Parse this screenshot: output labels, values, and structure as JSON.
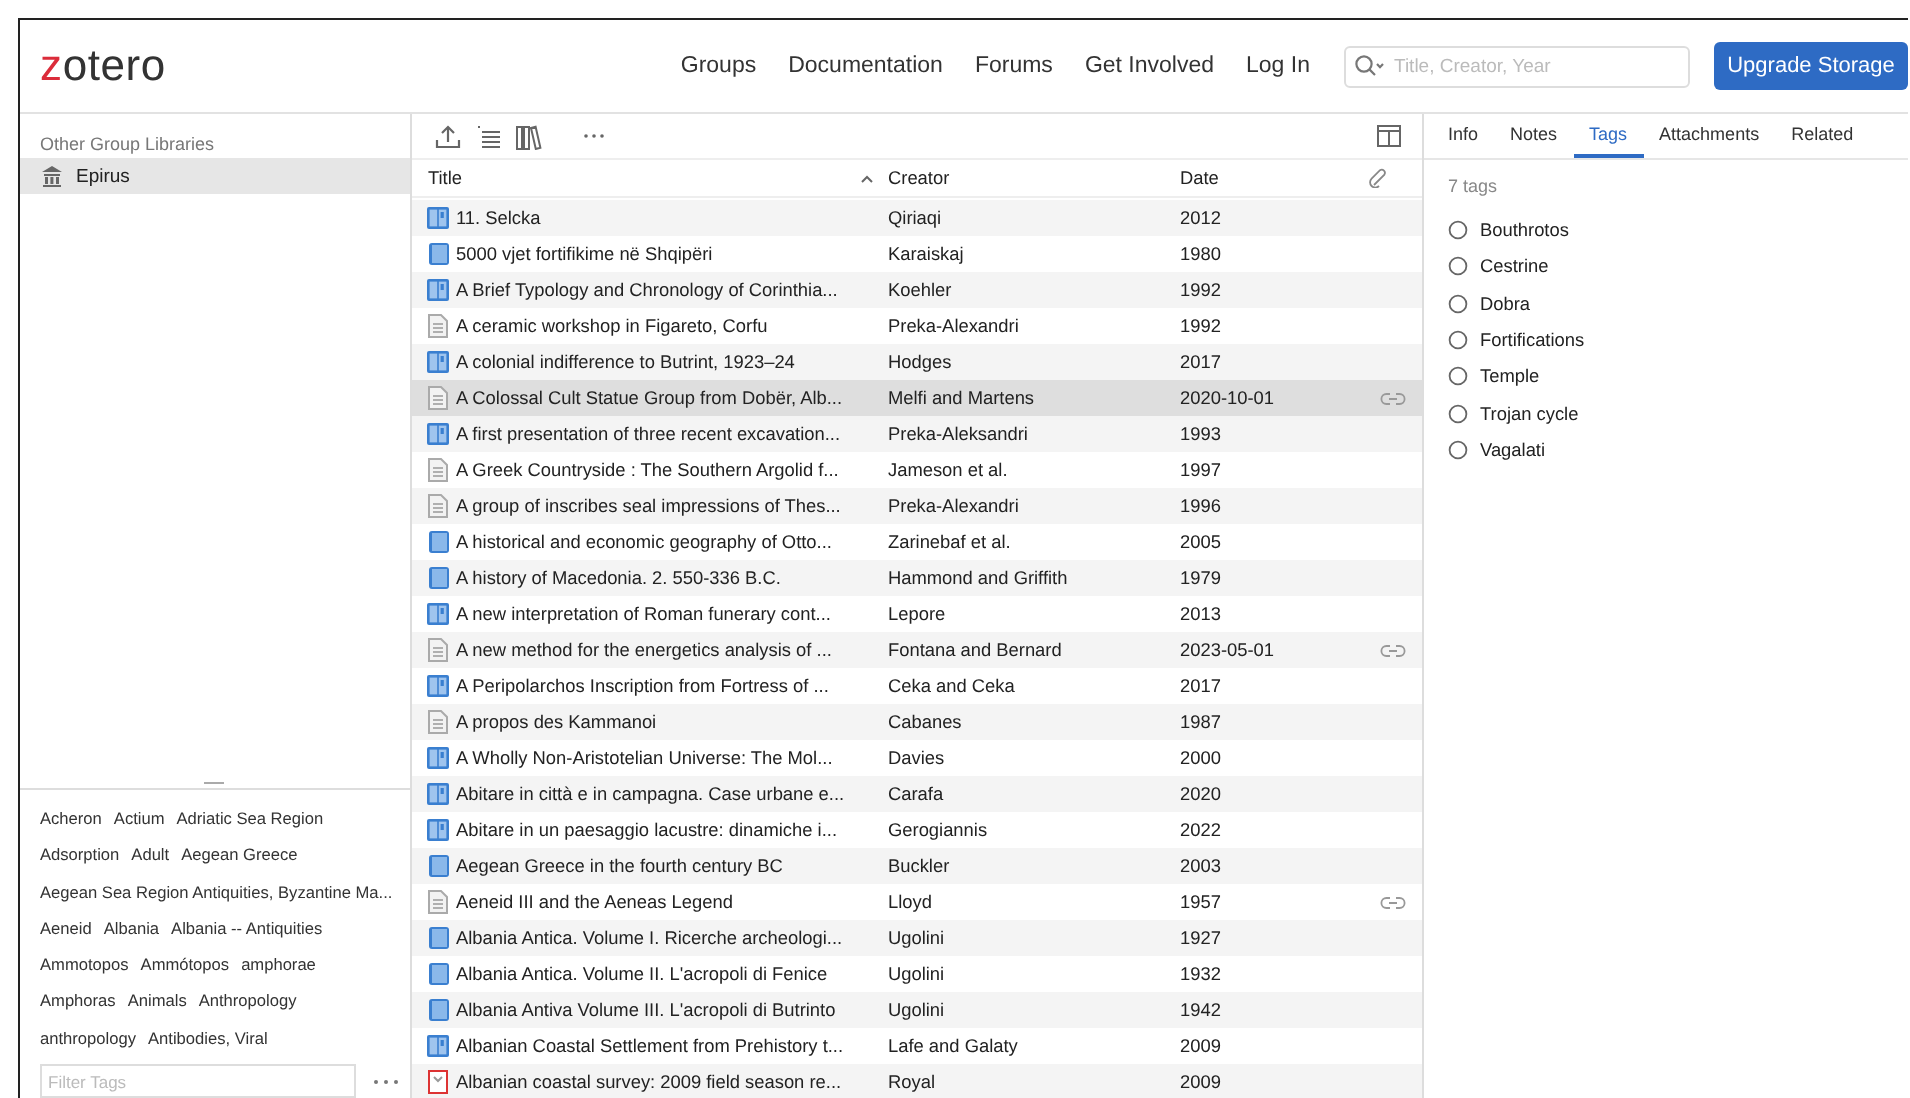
{
  "header": {
    "logo": {
      "accent": "z",
      "rest": "otero"
    },
    "nav": [
      "Groups",
      "Documentation",
      "Forums",
      "Get Involved",
      "Log In"
    ],
    "search": {
      "placeholder": "Title, Creator, Year"
    },
    "upgrade_button": "Upgrade Storage"
  },
  "sidebar": {
    "heading": "Other Group Libraries",
    "items": [
      {
        "label": "Epirus",
        "selected": true
      }
    ],
    "tags": [
      "Acheron",
      "Actium",
      "Adriatic Sea Region",
      "Adsorption",
      "Adult",
      "Aegean Greece",
      "Aegean Sea Region Antiquities, Byzantine Ma...",
      "Aeneid",
      "Albania",
      "Albania -- Antiquities",
      "Ammotopos",
      "Ammótopos",
      "amphorae",
      "Amphoras",
      "Animals",
      "Anthropology",
      "anthropology",
      "Antibodies, Viral"
    ],
    "filter": {
      "placeholder": "Filter Tags"
    }
  },
  "table": {
    "columns": [
      "Title",
      "Creator",
      "Date"
    ],
    "rows": [
      {
        "kind": "section",
        "title": "11. Selcka",
        "creator": "Qiriaqi",
        "date": "2012",
        "attachment": false,
        "selected": false
      },
      {
        "kind": "book",
        "title": "5000 vjet fortifikime në Shqipëri",
        "creator": "Karaiskaj",
        "date": "1980",
        "attachment": false,
        "selected": false
      },
      {
        "kind": "section",
        "title": "A Brief Typology and Chronology of Corinthia...",
        "creator": "Koehler",
        "date": "1992",
        "attachment": false,
        "selected": false
      },
      {
        "kind": "document",
        "title": "A ceramic workshop in Figareto, Corfu",
        "creator": "Preka-Alexandri",
        "date": "1992",
        "attachment": false,
        "selected": false
      },
      {
        "kind": "section",
        "title": "A colonial indifference to Butrint, 1923–24",
        "creator": "Hodges",
        "date": "2017",
        "attachment": false,
        "selected": false
      },
      {
        "kind": "document",
        "title": "A Colossal Cult Statue Group from Dobër, Alb...",
        "creator": "Melfi and Martens",
        "date": "2020-10-01",
        "attachment": true,
        "selected": true
      },
      {
        "kind": "section",
        "title": "A first presentation of three recent excavation...",
        "creator": "Preka-Aleksandri",
        "date": "1993",
        "attachment": false,
        "selected": false
      },
      {
        "kind": "document",
        "title": "A Greek Countryside : The Southern Argolid f...",
        "creator": "Jameson et al.",
        "date": "1997",
        "attachment": false,
        "selected": false
      },
      {
        "kind": "document",
        "title": "A group of inscribes seal impressions of Thes...",
        "creator": "Preka-Alexandri",
        "date": "1996",
        "attachment": false,
        "selected": false
      },
      {
        "kind": "book",
        "title": "A historical and economic geography of Otto...",
        "creator": "Zarinebaf et al.",
        "date": "2005",
        "attachment": false,
        "selected": false
      },
      {
        "kind": "book",
        "title": "A history of Macedonia. 2. 550-336 B.C.",
        "creator": "Hammond and Griffith",
        "date": "1979",
        "attachment": false,
        "selected": false
      },
      {
        "kind": "section",
        "title": "A new interpretation of Roman funerary cont...",
        "creator": "Lepore",
        "date": "2013",
        "attachment": false,
        "selected": false
      },
      {
        "kind": "document",
        "title": "A new method for the energetics analysis of ...",
        "creator": "Fontana and Bernard",
        "date": "2023-05-01",
        "attachment": true,
        "selected": false
      },
      {
        "kind": "section",
        "title": "A Peripolarchos Inscription from Fortress of ...",
        "creator": "Ceka and Ceka",
        "date": "2017",
        "attachment": false,
        "selected": false
      },
      {
        "kind": "document",
        "title": "A propos des Kammanoi",
        "creator": "Cabanes",
        "date": "1987",
        "attachment": false,
        "selected": false
      },
      {
        "kind": "section",
        "title": "A Wholly Non-Aristotelian Universe: The Mol...",
        "creator": "Davies",
        "date": "2000",
        "attachment": false,
        "selected": false
      },
      {
        "kind": "section",
        "title": "Abitare in città e in campagna. Case urbane e...",
        "creator": "Carafa",
        "date": "2020",
        "attachment": false,
        "selected": false
      },
      {
        "kind": "section",
        "title": "Abitare in un paesaggio lacustre: dinamiche i...",
        "creator": "Gerogiannis",
        "date": "2022",
        "attachment": false,
        "selected": false
      },
      {
        "kind": "book",
        "title": "Aegean Greece in the fourth century BC",
        "creator": "Buckler",
        "date": "2003",
        "attachment": false,
        "selected": false
      },
      {
        "kind": "document",
        "title": "Aeneid III and the Aeneas Legend",
        "creator": "Lloyd",
        "date": "1957",
        "attachment": true,
        "selected": false
      },
      {
        "kind": "book",
        "title": "Albania Antica. Volume I. Ricerche archeologi...",
        "creator": "Ugolini",
        "date": "1927",
        "attachment": false,
        "selected": false
      },
      {
        "kind": "book",
        "title": "Albania Antica. Volume II. L'acropoli di Fenice",
        "creator": "Ugolini",
        "date": "1932",
        "attachment": false,
        "selected": false
      },
      {
        "kind": "book",
        "title": "Albania Antiva Volume III. L'acropoli di Butrinto",
        "creator": "Ugolini",
        "date": "1942",
        "attachment": false,
        "selected": false
      },
      {
        "kind": "section",
        "title": "Albanian Coastal Settlement from Prehistory t...",
        "creator": "Lafe and Galaty",
        "date": "2009",
        "attachment": false,
        "selected": false
      },
      {
        "kind": "report",
        "title": "Albanian coastal survey: 2009 field season re...",
        "creator": "Royal",
        "date": "2009",
        "attachment": false,
        "selected": false
      }
    ]
  },
  "item_pane": {
    "tabs": [
      {
        "label": "Info",
        "selected": false
      },
      {
        "label": "Notes",
        "selected": false
      },
      {
        "label": "Tags",
        "selected": true
      },
      {
        "label": "Attachments",
        "selected": false
      },
      {
        "label": "Related",
        "selected": false
      }
    ],
    "count": "7 tags",
    "tags": [
      "Bouthrotos",
      "Cestrine",
      "Dobra",
      "Fortifications",
      "Temple",
      "Trojan cycle",
      "Vagalati"
    ]
  }
}
